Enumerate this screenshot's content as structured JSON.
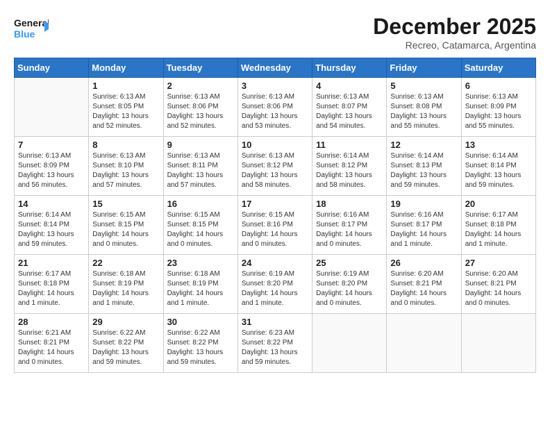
{
  "header": {
    "logo": {
      "general": "General",
      "blue": "Blue",
      "line_color": "#3399ff"
    },
    "month": "December 2025",
    "location": "Recreo, Catamarca, Argentina"
  },
  "days_of_week": [
    "Sunday",
    "Monday",
    "Tuesday",
    "Wednesday",
    "Thursday",
    "Friday",
    "Saturday"
  ],
  "weeks": [
    [
      {
        "day": "",
        "info": ""
      },
      {
        "day": "1",
        "info": "Sunrise: 6:13 AM\nSunset: 8:05 PM\nDaylight: 13 hours\nand 52 minutes."
      },
      {
        "day": "2",
        "info": "Sunrise: 6:13 AM\nSunset: 8:06 PM\nDaylight: 13 hours\nand 52 minutes."
      },
      {
        "day": "3",
        "info": "Sunrise: 6:13 AM\nSunset: 8:06 PM\nDaylight: 13 hours\nand 53 minutes."
      },
      {
        "day": "4",
        "info": "Sunrise: 6:13 AM\nSunset: 8:07 PM\nDaylight: 13 hours\nand 54 minutes."
      },
      {
        "day": "5",
        "info": "Sunrise: 6:13 AM\nSunset: 8:08 PM\nDaylight: 13 hours\nand 55 minutes."
      },
      {
        "day": "6",
        "info": "Sunrise: 6:13 AM\nSunset: 8:09 PM\nDaylight: 13 hours\nand 55 minutes."
      }
    ],
    [
      {
        "day": "7",
        "info": "Sunrise: 6:13 AM\nSunset: 8:09 PM\nDaylight: 13 hours\nand 56 minutes."
      },
      {
        "day": "8",
        "info": "Sunrise: 6:13 AM\nSunset: 8:10 PM\nDaylight: 13 hours\nand 57 minutes."
      },
      {
        "day": "9",
        "info": "Sunrise: 6:13 AM\nSunset: 8:11 PM\nDaylight: 13 hours\nand 57 minutes."
      },
      {
        "day": "10",
        "info": "Sunrise: 6:13 AM\nSunset: 8:12 PM\nDaylight: 13 hours\nand 58 minutes."
      },
      {
        "day": "11",
        "info": "Sunrise: 6:14 AM\nSunset: 8:12 PM\nDaylight: 13 hours\nand 58 minutes."
      },
      {
        "day": "12",
        "info": "Sunrise: 6:14 AM\nSunset: 8:13 PM\nDaylight: 13 hours\nand 59 minutes."
      },
      {
        "day": "13",
        "info": "Sunrise: 6:14 AM\nSunset: 8:14 PM\nDaylight: 13 hours\nand 59 minutes."
      }
    ],
    [
      {
        "day": "14",
        "info": "Sunrise: 6:14 AM\nSunset: 8:14 PM\nDaylight: 13 hours\nand 59 minutes."
      },
      {
        "day": "15",
        "info": "Sunrise: 6:15 AM\nSunset: 8:15 PM\nDaylight: 14 hours\nand 0 minutes."
      },
      {
        "day": "16",
        "info": "Sunrise: 6:15 AM\nSunset: 8:15 PM\nDaylight: 14 hours\nand 0 minutes."
      },
      {
        "day": "17",
        "info": "Sunrise: 6:15 AM\nSunset: 8:16 PM\nDaylight: 14 hours\nand 0 minutes."
      },
      {
        "day": "18",
        "info": "Sunrise: 6:16 AM\nSunset: 8:17 PM\nDaylight: 14 hours\nand 0 minutes."
      },
      {
        "day": "19",
        "info": "Sunrise: 6:16 AM\nSunset: 8:17 PM\nDaylight: 14 hours\nand 1 minute."
      },
      {
        "day": "20",
        "info": "Sunrise: 6:17 AM\nSunset: 8:18 PM\nDaylight: 14 hours\nand 1 minute."
      }
    ],
    [
      {
        "day": "21",
        "info": "Sunrise: 6:17 AM\nSunset: 8:18 PM\nDaylight: 14 hours\nand 1 minute."
      },
      {
        "day": "22",
        "info": "Sunrise: 6:18 AM\nSunset: 8:19 PM\nDaylight: 14 hours\nand 1 minute."
      },
      {
        "day": "23",
        "info": "Sunrise: 6:18 AM\nSunset: 8:19 PM\nDaylight: 14 hours\nand 1 minute."
      },
      {
        "day": "24",
        "info": "Sunrise: 6:19 AM\nSunset: 8:20 PM\nDaylight: 14 hours\nand 1 minute."
      },
      {
        "day": "25",
        "info": "Sunrise: 6:19 AM\nSunset: 8:20 PM\nDaylight: 14 hours\nand 0 minutes."
      },
      {
        "day": "26",
        "info": "Sunrise: 6:20 AM\nSunset: 8:21 PM\nDaylight: 14 hours\nand 0 minutes."
      },
      {
        "day": "27",
        "info": "Sunrise: 6:20 AM\nSunset: 8:21 PM\nDaylight: 14 hours\nand 0 minutes."
      }
    ],
    [
      {
        "day": "28",
        "info": "Sunrise: 6:21 AM\nSunset: 8:21 PM\nDaylight: 14 hours\nand 0 minutes."
      },
      {
        "day": "29",
        "info": "Sunrise: 6:22 AM\nSunset: 8:22 PM\nDaylight: 13 hours\nand 59 minutes."
      },
      {
        "day": "30",
        "info": "Sunrise: 6:22 AM\nSunset: 8:22 PM\nDaylight: 13 hours\nand 59 minutes."
      },
      {
        "day": "31",
        "info": "Sunrise: 6:23 AM\nSunset: 8:22 PM\nDaylight: 13 hours\nand 59 minutes."
      },
      {
        "day": "",
        "info": ""
      },
      {
        "day": "",
        "info": ""
      },
      {
        "day": "",
        "info": ""
      }
    ]
  ]
}
